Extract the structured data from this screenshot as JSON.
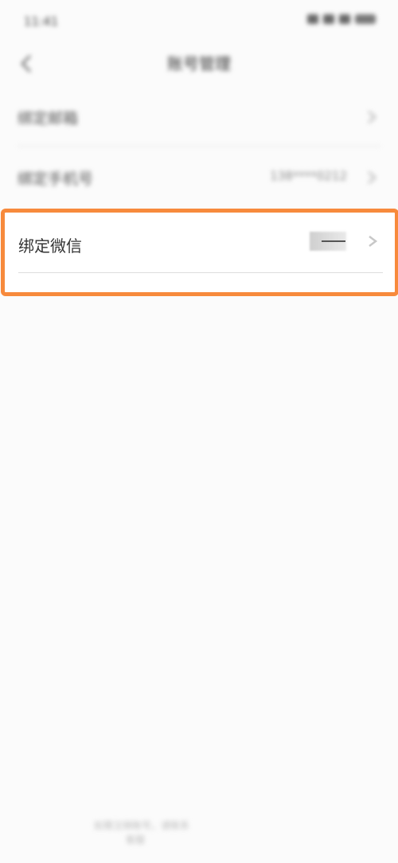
{
  "status_bar": {
    "time": "11:41"
  },
  "nav": {
    "title": "账号管理"
  },
  "rows": [
    {
      "label": "绑定邮箱",
      "value": ""
    },
    {
      "label": "绑定手机号",
      "value": "138****0212"
    }
  ],
  "wechat_row": {
    "label": "绑定微信"
  },
  "footer": {
    "line1": "如需注销账号，请联系",
    "line2": "客服"
  },
  "colors": {
    "highlight": "#f78a3c",
    "background": "#fbfbfb"
  },
  "icons": {
    "back": "back-icon",
    "chevron": "chevron-right-icon"
  }
}
